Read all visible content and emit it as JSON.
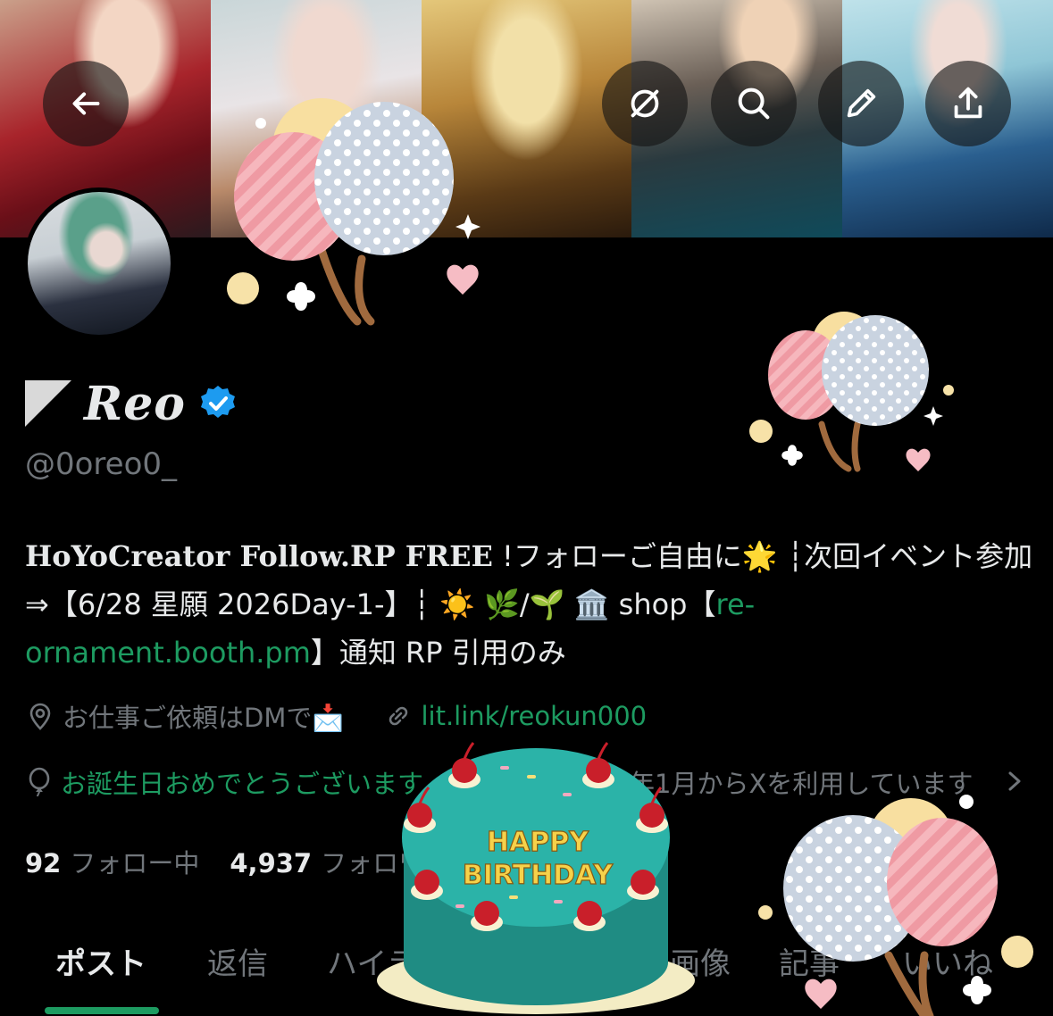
{
  "header": {
    "back_icon": "arrow-left-icon",
    "actions": [
      "grok-icon",
      "search-icon",
      "pencil-icon",
      "share-icon"
    ]
  },
  "profile": {
    "display_name": "Reo",
    "handle": "@0oreo0_",
    "verified": true,
    "bio": {
      "part1": "HoYoCreator Follow.RP FREE",
      "part2": " !フォローご自由に🌟 ┆次回イベント参加⇒【6/28 星願 2026Day-1-】┆ ☀️ 🌿/🌱 🏛️ shop【",
      "link": "re-ornament.booth.pm",
      "part3": "】通知 RP 引用のみ"
    },
    "location": "お仕事ご依頼はDMで📩",
    "website": "lit.link/reokun000",
    "birthday_message": "お誕生日おめでとうございます",
    "joined": "年1月からXを利用しています",
    "stats": {
      "following_count": "92",
      "following_label": "フォロー中",
      "followers_count": "4,937",
      "followers_label": "フォロワー"
    }
  },
  "tabs": [
    {
      "label": "ポスト",
      "active": true
    },
    {
      "label": "返信",
      "active": false
    },
    {
      "label": "ハイライト",
      "active": false
    },
    {
      "label": "画像",
      "active": false
    },
    {
      "label": "記事",
      "active": false
    },
    {
      "label": "いいね",
      "active": false
    }
  ],
  "overlay": {
    "cake_text_line1": "HAPPY",
    "cake_text_line2": "BIRTHDAY"
  },
  "colors": {
    "background": "#000000",
    "text": "#e7e9ea",
    "muted": "#71767b",
    "accent_green": "#1d9b61",
    "verified_blue": "#1d9bf0"
  }
}
